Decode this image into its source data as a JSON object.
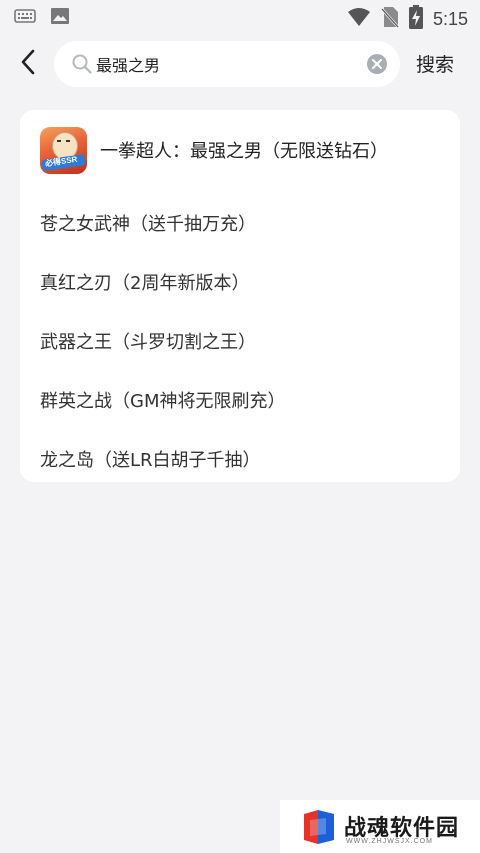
{
  "status_bar": {
    "time": "5:15",
    "icons": [
      "keyboard-icon",
      "image-icon",
      "wifi-icon",
      "no-sim-icon",
      "battery-charging-icon"
    ]
  },
  "header": {
    "back_icon": "chevron-left-icon",
    "search": {
      "value": "最强之男",
      "placeholder": "",
      "icon": "search-icon",
      "clear_icon": "clear-icon"
    },
    "submit_label": "搜索"
  },
  "results": {
    "top_result": {
      "title": "一拳超人：最强之男（无限送钻石）",
      "icon_badge": "必得SSR"
    },
    "items": [
      {
        "label": "苍之女武神（送千抽万充）"
      },
      {
        "label": "真红之刃（2周年新版本）"
      },
      {
        "label": "武器之王（斗罗切割之王）"
      },
      {
        "label": "群英之战（GM神将无限刷充）"
      },
      {
        "label": "龙之岛（送LR白胡子千抽）"
      }
    ]
  },
  "watermark": {
    "text": "战魂软件园",
    "url": "WWW.ZHJWSJX.COM"
  },
  "colors": {
    "background": "#f3f3f5",
    "card": "#ffffff",
    "text": "#222222",
    "clear_icon": "#a9adb5"
  }
}
